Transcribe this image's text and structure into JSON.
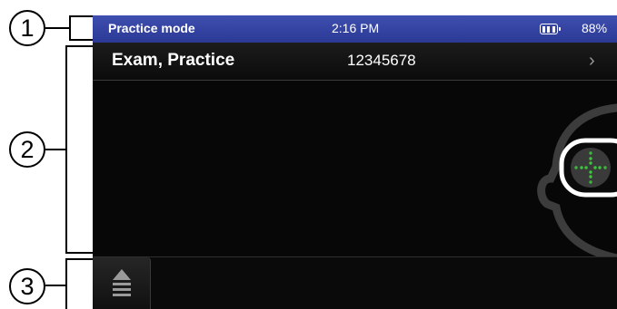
{
  "callouts": [
    "1",
    "2",
    "3"
  ],
  "statusbar": {
    "title": "Practice mode",
    "time": "2:16 PM",
    "battery_percent": "88%",
    "battery_level": 0.88
  },
  "patient": {
    "name": "Exam, Practice",
    "id": "12345678",
    "chevron": "›"
  },
  "icons": {
    "battery": "battery-icon",
    "face": "face-goggles-icon",
    "eject": "eject-icon"
  },
  "colors": {
    "statusbar": "#3445a8",
    "screen_background": "#070707",
    "target_dots": "#3cc63c"
  }
}
